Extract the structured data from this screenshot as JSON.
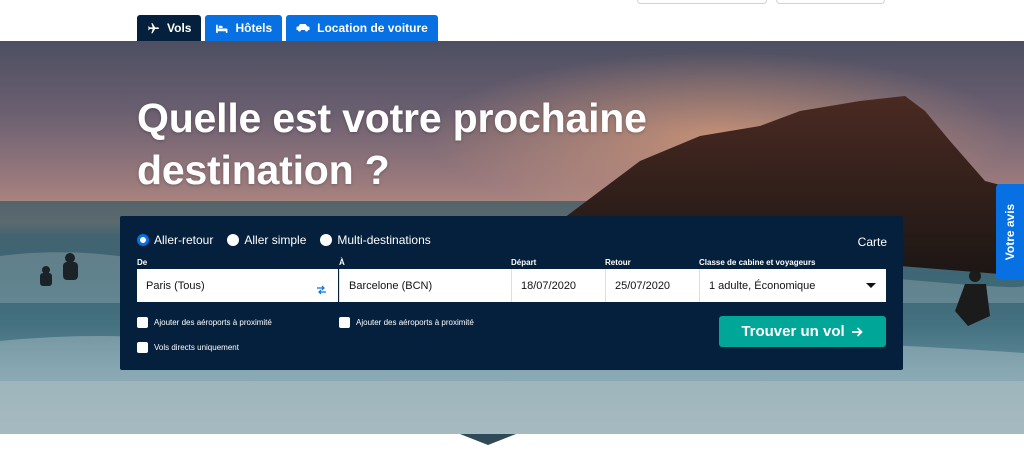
{
  "tabs": [
    {
      "label": "Vols",
      "icon": "airplane-icon",
      "active": true
    },
    {
      "label": "Hôtels",
      "icon": "bed-icon",
      "active": false
    },
    {
      "label": "Location de voiture",
      "icon": "car-icon",
      "active": false
    }
  ],
  "hero": {
    "headline": "Quelle est votre prochaine destination ?",
    "feedback_label": "Votre avis"
  },
  "search": {
    "trip_types": [
      {
        "label": "Aller-retour",
        "selected": true
      },
      {
        "label": "Aller simple",
        "selected": false
      },
      {
        "label": "Multi-destinations",
        "selected": false
      }
    ],
    "map_link": "Carte",
    "from": {
      "label": "De",
      "value": "Paris (Tous)"
    },
    "to": {
      "label": "À",
      "value": "Barcelone (BCN)"
    },
    "depart": {
      "label": "Départ",
      "value": "18/07/2020"
    },
    "return": {
      "label": "Retour",
      "value": "25/07/2020"
    },
    "cabin": {
      "label": "Classe de cabine et voyageurs",
      "value": "1 adulte, Économique"
    },
    "nearby_from_label": "Ajouter des aéroports à proximité",
    "nearby_to_label": "Ajouter des aéroports à proximité",
    "direct_only_label": "Vols directs uniquement",
    "submit_label": "Trouver un vol",
    "accent_color": "#00a698"
  },
  "colors": {
    "navy": "#05203c",
    "blue": "#0770e3"
  }
}
